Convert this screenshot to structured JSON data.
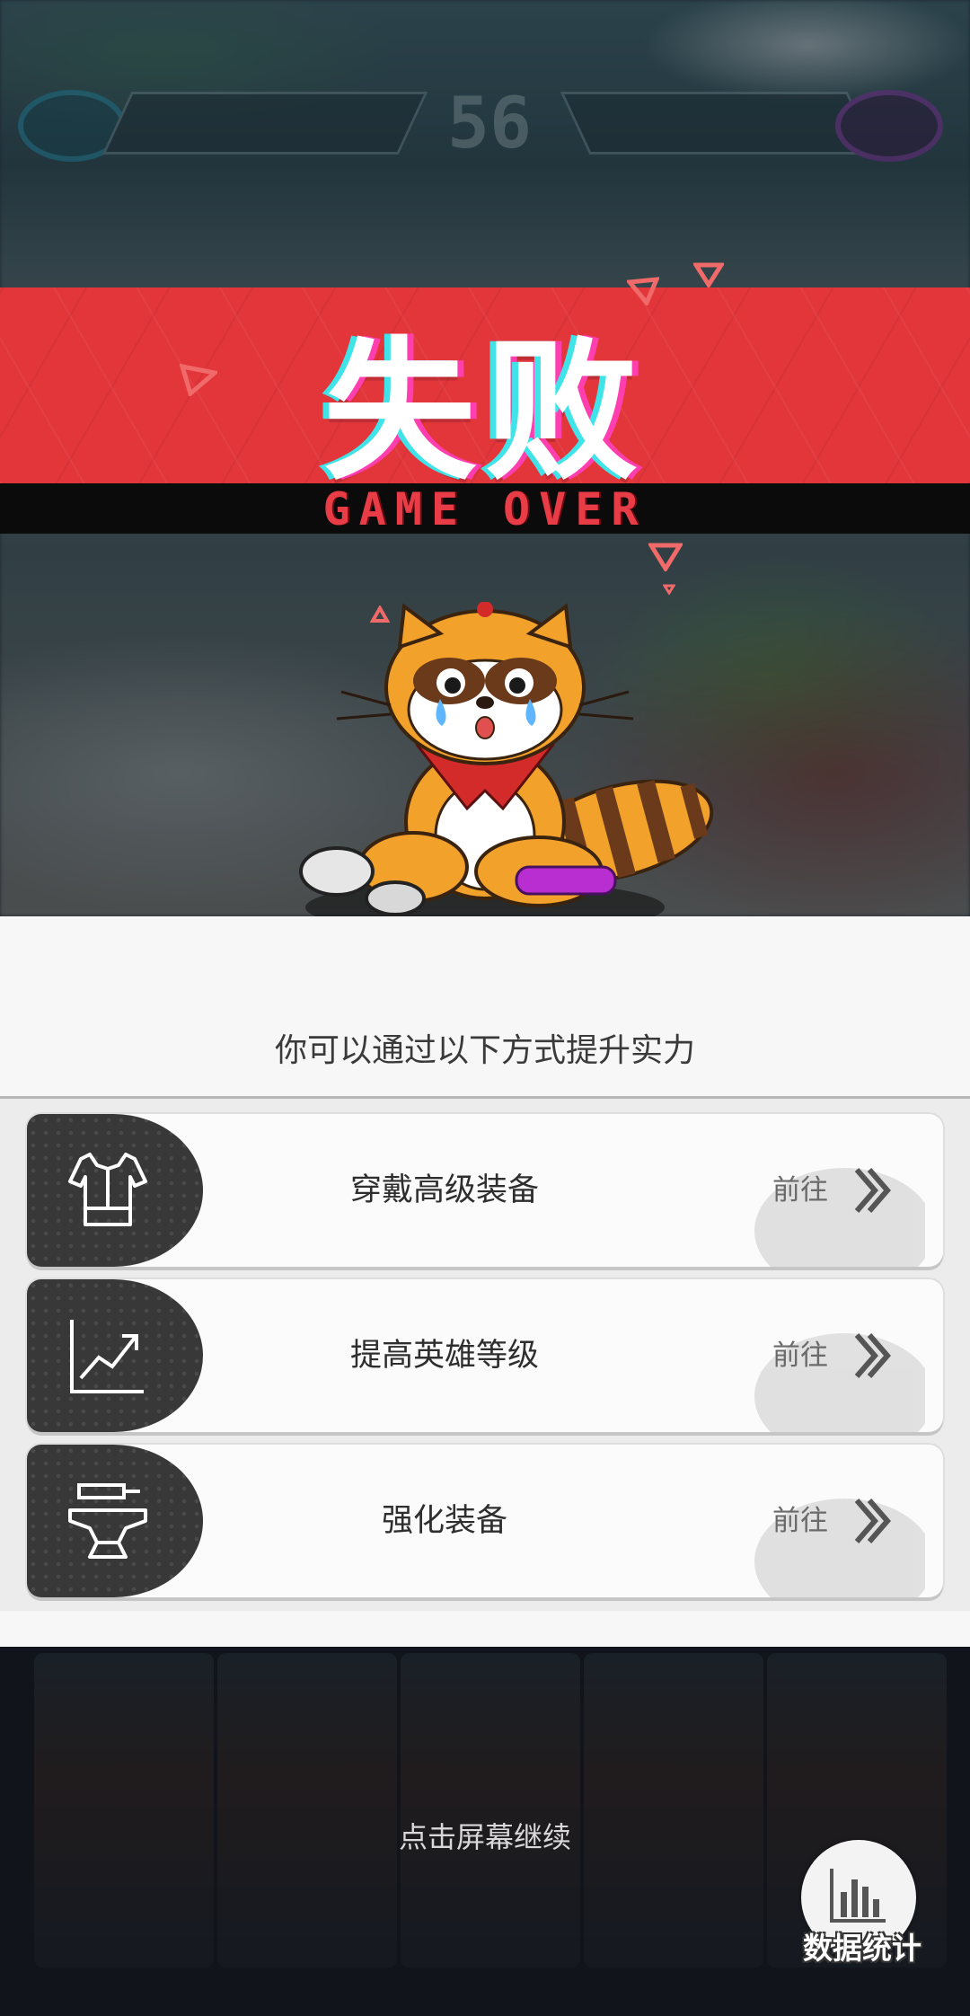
{
  "hud": {
    "timer": "56"
  },
  "banner": {
    "title": "失败",
    "subtitle": "GAME OVER",
    "accent_color": "#e2363b"
  },
  "hint": {
    "text": "你可以通过以下方式提升实力"
  },
  "options": [
    {
      "label": "穿戴高级装备",
      "action": "前往",
      "icon": "armor-icon"
    },
    {
      "label": "提高英雄等级",
      "action": "前往",
      "icon": "level-up-chart-icon"
    },
    {
      "label": "强化装备",
      "action": "前往",
      "icon": "anvil-icon"
    }
  ],
  "footer": {
    "continue_text": "点击屏幕继续",
    "stats_label": "数据统计",
    "stats_icon": "bar-chart-icon"
  }
}
